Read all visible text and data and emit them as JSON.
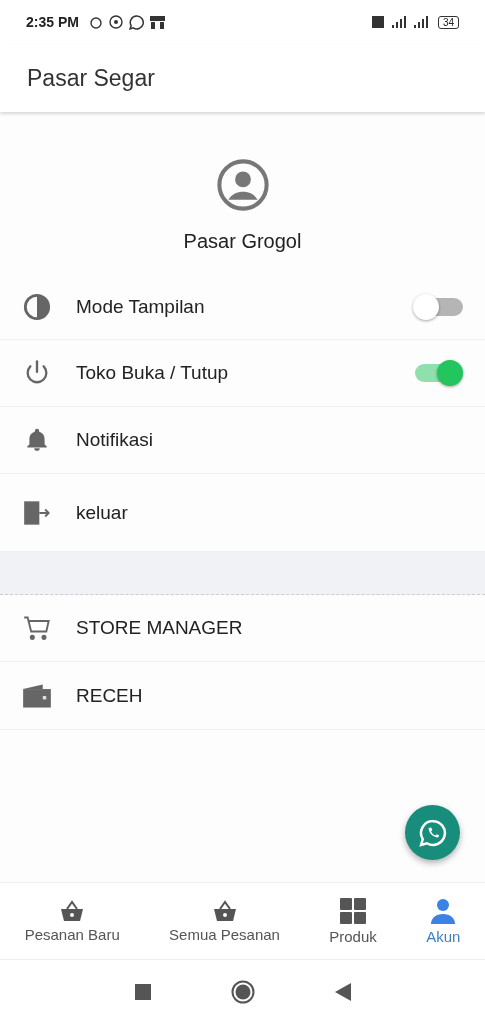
{
  "status_bar": {
    "time": "2:35 PM",
    "battery": "34"
  },
  "app_bar": {
    "title": "Pasar Segar"
  },
  "profile": {
    "name": "Pasar Grogol"
  },
  "settings": [
    {
      "kind": "toggle",
      "label": "Mode Tampilan",
      "on": false
    },
    {
      "kind": "toggle",
      "label": "Toko Buka / Tutup",
      "on": true
    },
    {
      "kind": "link",
      "label": "Notifikasi"
    },
    {
      "kind": "link",
      "label": "keluar"
    }
  ],
  "apps": [
    {
      "label": "STORE MANAGER"
    },
    {
      "label": "RECEH"
    }
  ],
  "bottom_nav": [
    {
      "label": "Pesanan Baru",
      "selected": false
    },
    {
      "label": "Semua Pesanan",
      "selected": false
    },
    {
      "label": "Produk",
      "selected": false
    },
    {
      "label": "Akun",
      "selected": true
    }
  ]
}
